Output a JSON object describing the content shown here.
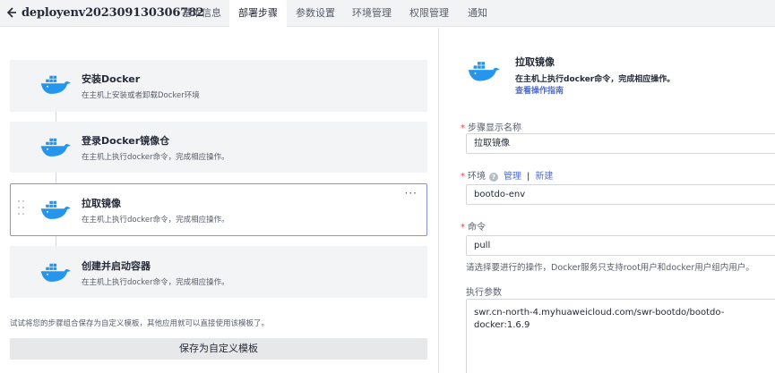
{
  "header": {
    "title": "deployenv202309130306782",
    "tabs": [
      {
        "label": "基本信息",
        "active": false
      },
      {
        "label": "部署步骤",
        "active": true
      },
      {
        "label": "参数设置",
        "active": false
      },
      {
        "label": "环境管理",
        "active": false
      },
      {
        "label": "权限管理",
        "active": false
      },
      {
        "label": "通知",
        "active": false
      }
    ]
  },
  "steps": [
    {
      "name": "安装Docker",
      "desc": "在主机上安装或者卸载Docker环境"
    },
    {
      "name": "登录Docker镜像仓",
      "desc": "在主机上执行docker命令，完成相应操作。"
    },
    {
      "name": "拉取镜像",
      "desc": "在主机上执行docker命令，完成相应操作。"
    },
    {
      "name": "创建并启动容器",
      "desc": "在主机上执行docker命令，完成相应操作。"
    }
  ],
  "template_hint": "试试将您的步骤组合保存为自定义模板，其他应用就可以直接使用该模板了。",
  "save_template_label": "保存为自定义模板",
  "detail": {
    "title": "拉取镜像",
    "desc": "在主机上执行docker命令，完成相应操作。",
    "guide_link": "查看操作指南",
    "display_name_label": "步骤显示名称",
    "display_name_value": "拉取镜像",
    "env_label": "环境",
    "env_help_icon": "?",
    "env_manage_link": "管理",
    "env_separator": "|",
    "env_new_link": "新建",
    "env_value": "bootdo-env",
    "command_label": "命令",
    "command_value": "pull",
    "command_help": "请选择要进行的操作，Docker服务只支持root用户和docker用户组内用户。",
    "params_label": "执行参数",
    "params_value": "swr.cn-north-4.myhuaweicloud.com/swr-bootdo/bootdo-docker:1.6.9",
    "required_mark": "*"
  },
  "icons": {
    "back": "arrow-left-icon",
    "step": "docker-whale-icon",
    "drag": "drag-handle-icon",
    "more": "more-dots-icon"
  },
  "colors": {
    "accent": "#526ecc",
    "selected_border": "#7f96d8",
    "required": "#e54545",
    "docker_blue": "#2496ed"
  }
}
